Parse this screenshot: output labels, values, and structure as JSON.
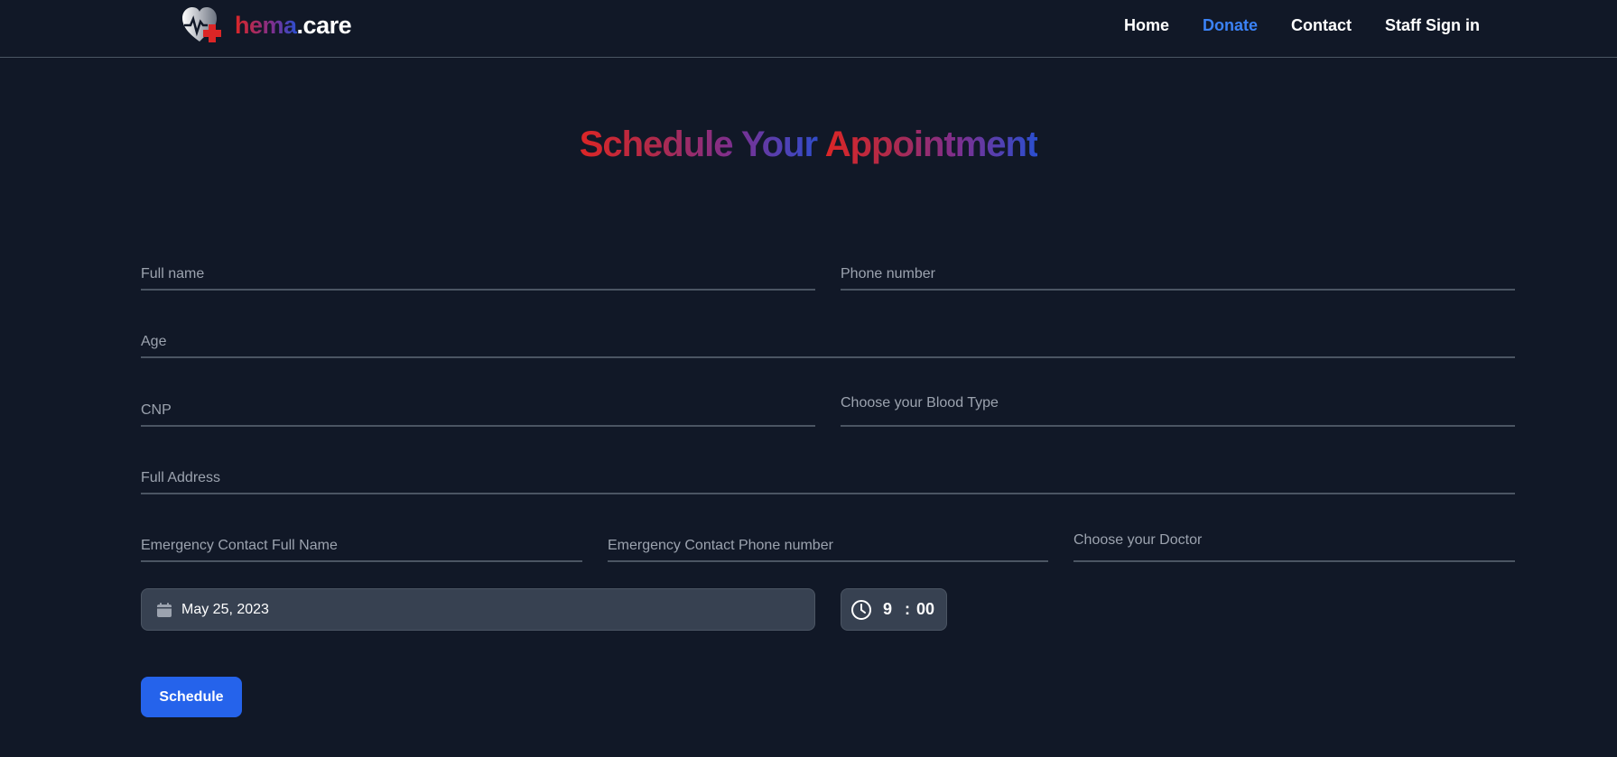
{
  "brand": {
    "name_part1": "hema",
    "name_part2": ".care",
    "logo_icon": "heart-cross-icon"
  },
  "nav": {
    "home": "Home",
    "donate": "Donate",
    "contact": "Contact",
    "staff_sign_in": "Staff Sign in",
    "active": "Donate"
  },
  "title": {
    "part1": "Schedule Your ",
    "part2": "Appointment"
  },
  "form": {
    "full_name_placeholder": "Full name",
    "phone_placeholder": "Phone number",
    "age_placeholder": "Age",
    "cnp_placeholder": "CNP",
    "blood_type_label": "Choose your Blood Type",
    "address_placeholder": "Full Address",
    "emergency_name_placeholder": "Emergency Contact Full Name",
    "emergency_phone_placeholder": "Emergency Contact Phone number",
    "doctor_label": "Choose your Doctor",
    "date_value": "May 25, 2023",
    "time_hour": "9",
    "time_separator": ":",
    "time_minute": "00",
    "submit_label": "Schedule"
  },
  "colors": {
    "background": "#111827",
    "accent": "#2563eb",
    "active_link": "#3b82f6",
    "brand_red": "#dc2626",
    "brand_purple": "#7e2f8e",
    "brand_blue": "#2b4fd0"
  }
}
